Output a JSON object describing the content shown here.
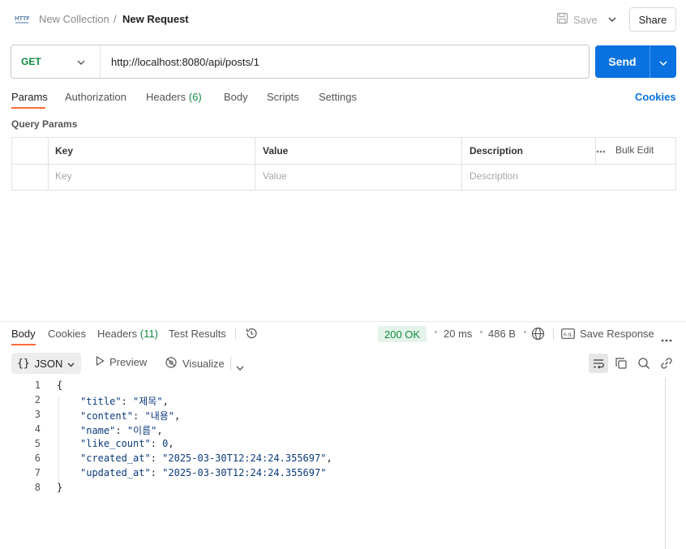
{
  "header": {
    "icon_text": "HTTP",
    "collection": "New Collection",
    "separator": "/",
    "request_name": "New Request",
    "save_label": "Save",
    "share_label": "Share"
  },
  "request": {
    "method": "GET",
    "url": "http://localhost:8080/api/posts/1",
    "send_label": "Send"
  },
  "tabs": {
    "params": "Params",
    "authorization": "Authorization",
    "headers": "Headers",
    "headers_count": "(6)",
    "body": "Body",
    "scripts": "Scripts",
    "settings": "Settings",
    "cookies": "Cookies"
  },
  "query_params": {
    "title": "Query Params",
    "columns": [
      "Key",
      "Value",
      "Description"
    ],
    "bulk_edit": "Bulk Edit",
    "placeholders": [
      "Key",
      "Value",
      "Description"
    ]
  },
  "response": {
    "tabs": {
      "body": "Body",
      "cookies": "Cookies",
      "headers": "Headers",
      "headers_count": "(11)",
      "test_results": "Test Results"
    },
    "status": "200 OK",
    "time": "20 ms",
    "size": "486 B",
    "save_response": "Save Response",
    "format": "JSON",
    "preview": "Preview",
    "visualize": "Visualize",
    "lines": [
      {
        "n": "1",
        "indent": 0,
        "parts": [
          [
            "p",
            "{"
          ]
        ]
      },
      {
        "n": "2",
        "indent": 1,
        "parts": [
          [
            "k",
            "\"title\""
          ],
          [
            "p",
            ": "
          ],
          [
            "s",
            "\"제목\""
          ],
          [
            "p",
            ","
          ]
        ]
      },
      {
        "n": "3",
        "indent": 1,
        "parts": [
          [
            "k",
            "\"content\""
          ],
          [
            "p",
            ": "
          ],
          [
            "s",
            "\"내용\""
          ],
          [
            "p",
            ","
          ]
        ]
      },
      {
        "n": "4",
        "indent": 1,
        "parts": [
          [
            "k",
            "\"name\""
          ],
          [
            "p",
            ": "
          ],
          [
            "s",
            "\"이름\""
          ],
          [
            "p",
            ","
          ]
        ]
      },
      {
        "n": "5",
        "indent": 1,
        "parts": [
          [
            "k",
            "\"like_count\""
          ],
          [
            "p",
            ": "
          ],
          [
            "n",
            "0"
          ],
          [
            "p",
            ","
          ]
        ]
      },
      {
        "n": "6",
        "indent": 1,
        "parts": [
          [
            "k",
            "\"created_at\""
          ],
          [
            "p",
            ": "
          ],
          [
            "s",
            "\"2025-03-30T12:24:24.355697\""
          ],
          [
            "p",
            ","
          ]
        ]
      },
      {
        "n": "7",
        "indent": 1,
        "parts": [
          [
            "k",
            "\"updated_at\""
          ],
          [
            "p",
            ": "
          ],
          [
            "s",
            "\"2025-03-30T12:24:24.355697\""
          ]
        ]
      },
      {
        "n": "8",
        "indent": 0,
        "parts": [
          [
            "p",
            "}"
          ]
        ]
      }
    ]
  },
  "colors": {
    "accent": "#ff6c37",
    "send": "#0a72e0",
    "method": "#0f8a3f",
    "status": "#0f8a3f"
  }
}
